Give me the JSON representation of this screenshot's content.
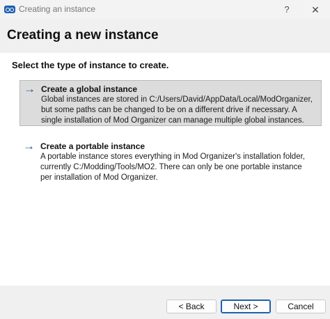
{
  "window": {
    "title": "Creating an instance",
    "help_label": "?",
    "close_label": "✕"
  },
  "page": {
    "title": "Creating a new instance",
    "subtitle": "Select the type of instance to create."
  },
  "options": [
    {
      "arrow": "→",
      "title": "Create a global instance",
      "desc_lines": [
        "Global instances are stored in C:/Users/David/AppData/Local/ModOrganizer,",
        "but some paths can be changed to be on a different drive if necessary. A",
        "single installation of Mod Organizer can manage multiple global instances."
      ],
      "selected": true
    },
    {
      "arrow": "→",
      "title": "Create a portable instance",
      "desc_lines": [
        "A portable instance stores everything in Mod Organizer's installation folder,",
        "currently C:/Modding/Tools/MO2. There can only be one portable instance",
        "per installation of Mod Organizer."
      ],
      "selected": false
    }
  ],
  "buttons": {
    "back": "< Back",
    "next": "Next >",
    "cancel": "Cancel"
  },
  "colors": {
    "accent": "#1f5fb0",
    "arrow": "#1f4e9e",
    "selected_bg": "#dcdcdc"
  }
}
